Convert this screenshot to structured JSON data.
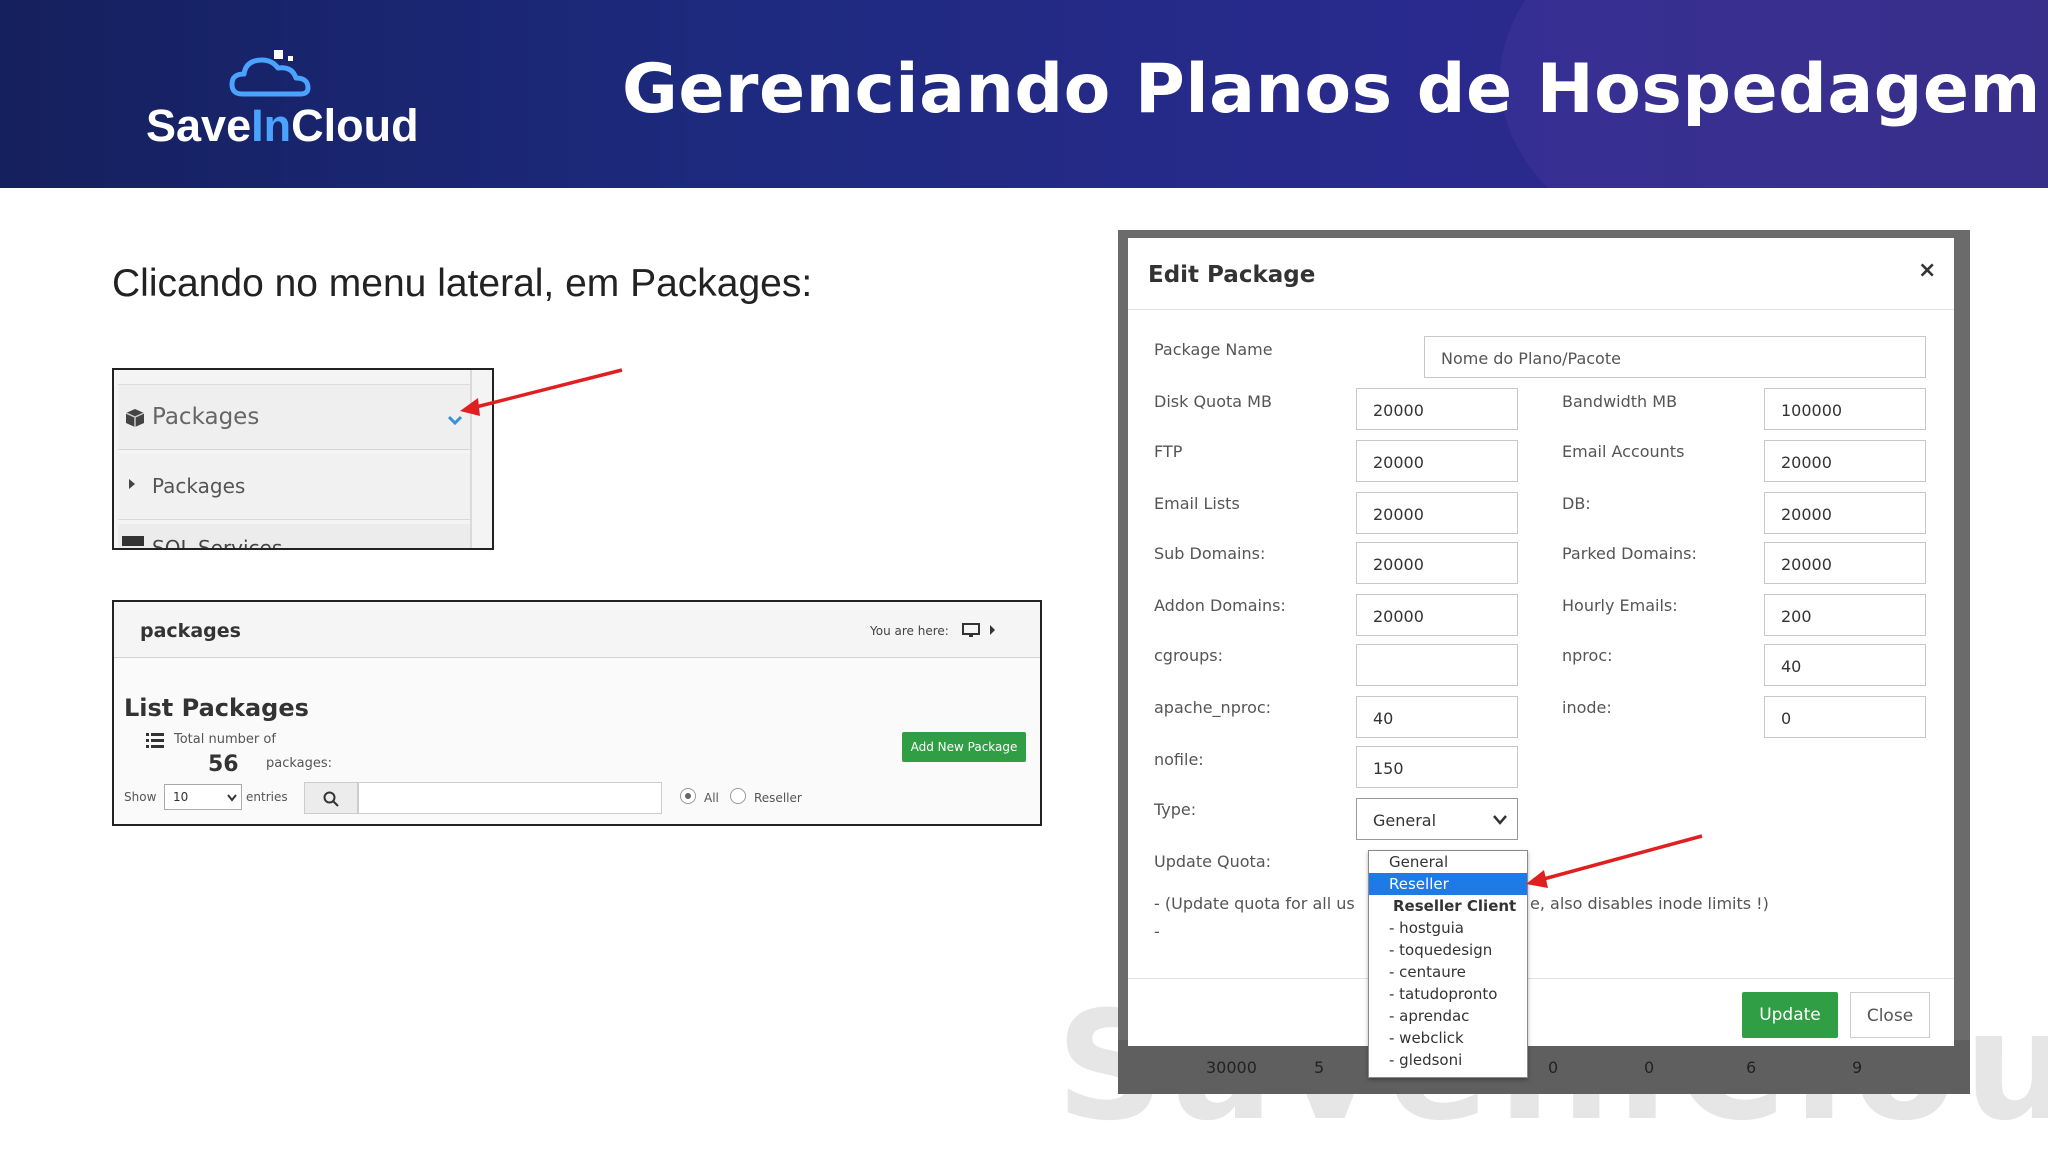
{
  "header": {
    "title": "Gerenciando Planos de Hospedagem",
    "logo": {
      "prefix": "Save",
      "middle": "In",
      "suffix": "Cloud"
    }
  },
  "intro": "Clicando no menu lateral, em Packages:",
  "sidebar_snippet": {
    "menu_label": "Packages",
    "submenu_label": "Packages",
    "cut_item": "SQL Services"
  },
  "packages_panel": {
    "breadcrumb_title": "packages",
    "you_are_here": "You are here:",
    "heading": "List Packages",
    "total_label_1": "Total number of",
    "total_count": "56",
    "total_label_2": "packages:",
    "add_button": "Add New Package",
    "show_label": "Show",
    "entries_value": "10",
    "entries_label": "entries",
    "filter_all": "All",
    "filter_reseller": "Reseller"
  },
  "edit_dialog": {
    "title": "Edit Package",
    "close_x": "×",
    "package_name": {
      "label": "Package Name",
      "placeholder": "Nome do Plano/Pacote"
    },
    "left_fields": [
      {
        "label": "Disk Quota MB",
        "value": "20000"
      },
      {
        "label": "FTP",
        "value": "20000"
      },
      {
        "label": "Email Lists",
        "value": "20000"
      },
      {
        "label": "Sub Domains:",
        "value": "20000"
      },
      {
        "label": "Addon Domains:",
        "value": "20000"
      },
      {
        "label": "cgroups:",
        "value": ""
      },
      {
        "label": "apache_nproc:",
        "value": "40"
      },
      {
        "label": "nofile:",
        "value": "150"
      }
    ],
    "right_fields": [
      {
        "label": "Bandwidth MB",
        "value": "100000"
      },
      {
        "label": "Email Accounts",
        "value": "20000"
      },
      {
        "label": "DB:",
        "value": "20000"
      },
      {
        "label": "Parked Domains:",
        "value": "20000"
      },
      {
        "label": "Hourly Emails:",
        "value": "200"
      },
      {
        "label": "nproc:",
        "value": "40"
      },
      {
        "label": "inode:",
        "value": "0"
      }
    ],
    "type_label": "Type:",
    "type_value": "General",
    "update_quota_label": "Update Quota:",
    "update_note_left": "- (Update quota for all us",
    "update_note_right": "e, also disables inode limits !)",
    "dash": "-",
    "update_button": "Update",
    "close_button": "Close",
    "type_options": [
      {
        "label": "General",
        "kind": "option"
      },
      {
        "label": "Reseller",
        "kind": "selected"
      },
      {
        "label": "Reseller Client",
        "kind": "group"
      },
      {
        "label": "- hostguia",
        "kind": "option"
      },
      {
        "label": "- toquedesign",
        "kind": "option"
      },
      {
        "label": "- centaure",
        "kind": "option"
      },
      {
        "label": "- tatudopronto",
        "kind": "option"
      },
      {
        "label": "- aprendac",
        "kind": "option"
      },
      {
        "label": "- webclick",
        "kind": "option"
      },
      {
        "label": "- gledsoni",
        "kind": "option"
      }
    ],
    "background_row": [
      "30000",
      "5",
      "0",
      "0",
      "6",
      "9"
    ]
  },
  "watermark": "SaveInCloud",
  "colors": {
    "header_bg": "#1d2a7e",
    "logo_accent": "#4aa3ff",
    "button_green": "#2f9e44",
    "selected_blue": "#1e7ae6",
    "arrow_red": "#e02020"
  }
}
